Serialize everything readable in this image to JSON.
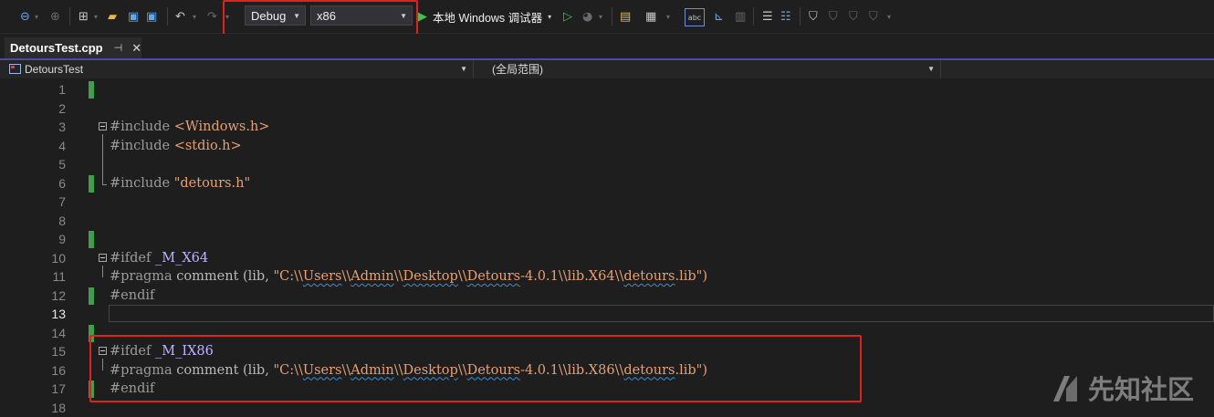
{
  "toolbar": {
    "configuration": "Debug",
    "platform": "x86",
    "debugger_label": "本地 Windows 调试器",
    "icons": [
      "back-icon",
      "forward-icon",
      "new-project-icon",
      "open-icon",
      "save-icon",
      "save-all-icon",
      "undo-icon",
      "redo-icon",
      "start-without-debugging-icon",
      "hot-reload-icon",
      "solution-explorer-icon",
      "toolbox-icon",
      "spell-check-icon",
      "align-icon",
      "comment-icon",
      "uncomment-icon",
      "bookmark-icon",
      "bookmark-prev-icon",
      "bookmark-next-icon",
      "bookmark-clear-icon"
    ]
  },
  "tab": {
    "filename": "DetoursTest.cpp",
    "pin": "⊣",
    "close": "✕"
  },
  "navbar": {
    "project": "DetoursTest",
    "scope": "(全局范围)"
  },
  "editor": {
    "lines": [
      {
        "n": "1"
      },
      {
        "n": "2"
      },
      {
        "n": "3",
        "dir": "#include",
        "arg": "<Windows.h>"
      },
      {
        "n": "4",
        "dir": "#include",
        "arg": "<stdio.h>"
      },
      {
        "n": "5"
      },
      {
        "n": "6",
        "dir": "#include",
        "arg": "\"detours.h\""
      },
      {
        "n": "7"
      },
      {
        "n": "8"
      },
      {
        "n": "9"
      },
      {
        "n": "10",
        "dir": "#ifdef",
        "macro": "_M_X64"
      },
      {
        "n": "11",
        "dir": "#pragma",
        "rest": "comment (lib,",
        "path": [
          "\"C:\\\\",
          "Users",
          "\\\\",
          "Admin",
          "\\\\",
          "Desktop",
          "\\\\",
          "Detours",
          "-4.0.1\\\\lib.X64\\\\",
          "detours",
          ".lib\")"
        ]
      },
      {
        "n": "12",
        "dir": "#endif"
      },
      {
        "n": "13"
      },
      {
        "n": "14"
      },
      {
        "n": "15",
        "dir": "#ifdef",
        "macro": "_M_IX86"
      },
      {
        "n": "16",
        "dir": "#pragma",
        "rest": "comment (lib,",
        "path": [
          "\"C:\\\\",
          "Users",
          "\\\\",
          "Admin",
          "\\\\",
          "Desktop",
          "\\\\",
          "Detours",
          "-4.0.1\\\\lib.X86\\\\",
          "detours",
          ".lib\")"
        ]
      },
      {
        "n": "17",
        "dir": "#endif"
      },
      {
        "n": "18"
      }
    ]
  },
  "watermark": {
    "text": "先知社区"
  },
  "colors": {
    "highlight_box": "#e0211c",
    "change_bar": "#3ea04b",
    "tab_accent": "#4e4b9a"
  }
}
